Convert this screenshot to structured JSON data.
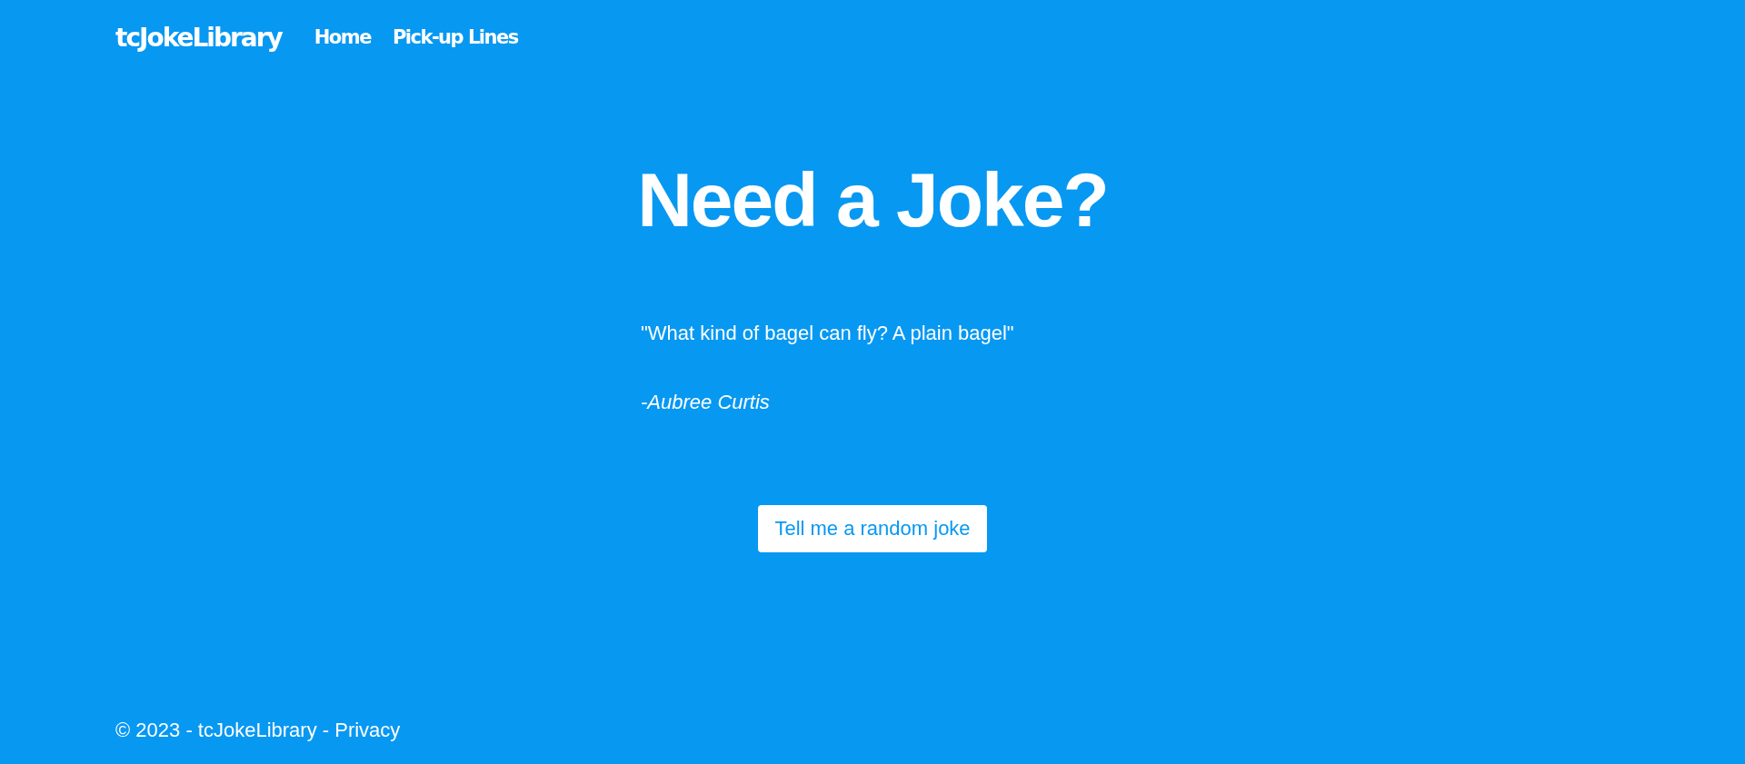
{
  "nav": {
    "brand": "tcJokeLibrary",
    "links": [
      "Home",
      "Pick-up Lines"
    ]
  },
  "heading": "Need a Joke?",
  "joke": {
    "text": "\"What kind of bagel can fly? A plain bagel\"",
    "author": "-Aubree Curtis"
  },
  "button": "Tell me a random joke",
  "footer": {
    "text": "© 2023 - tcJokeLibrary - ",
    "link": "Privacy"
  }
}
